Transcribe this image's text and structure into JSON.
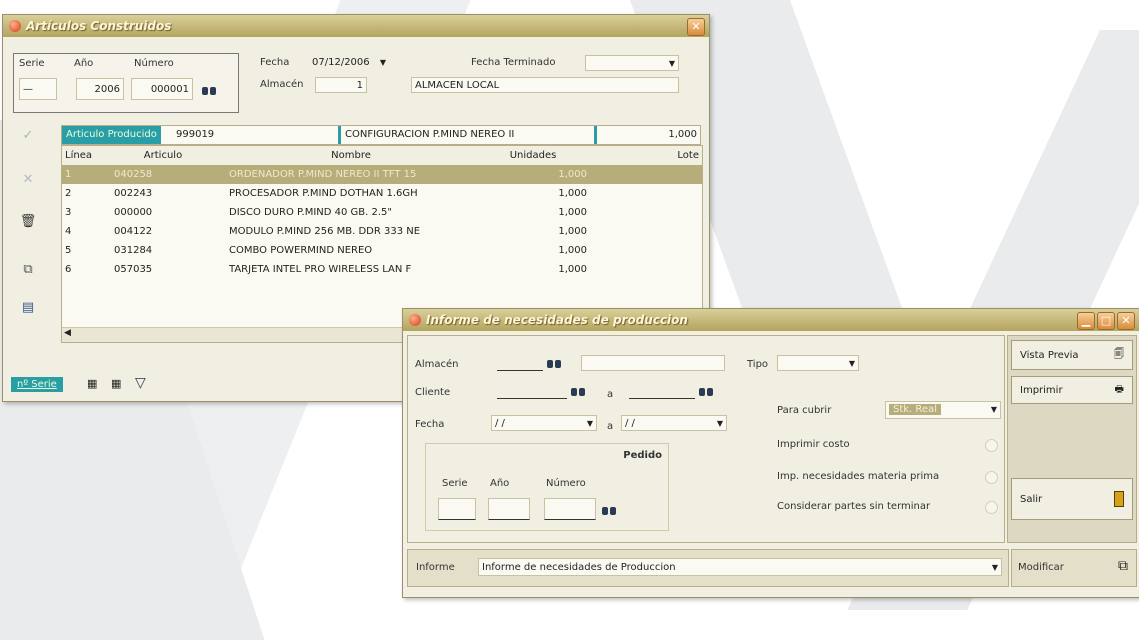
{
  "win1": {
    "title": "Artículos Construidos",
    "serie_label": "Serie",
    "anio_label": "Año",
    "numero_label": "Número",
    "serie_value": "—",
    "anio_value": "2006",
    "numero_value": "000001",
    "fecha_label": "Fecha",
    "fecha_value": "07/12/2006",
    "fecha_term_label": "Fecha Terminado",
    "fecha_term_value": "",
    "almacen_label": "Almacén",
    "almacen_value": "1",
    "almacen_name": "ALMACEN LOCAL",
    "producido_label": "Articulo Producido",
    "producido_code": "999019",
    "producido_name": "CONFIGURACION P.MIND NEREO II",
    "producido_qty": "1,000",
    "columns": [
      "Línea",
      "Articulo",
      "Nombre",
      "Unidades",
      "Lote"
    ],
    "rows": [
      {
        "line": "1",
        "article": "040258",
        "name": "ORDENADOR P.MIND NEREO II TFT 15",
        "units": "1,000",
        "lote": ""
      },
      {
        "line": "2",
        "article": "002243",
        "name": "PROCESADOR P.MIND DOTHAN 1.6GH",
        "units": "1,000",
        "lote": ""
      },
      {
        "line": "3",
        "article": "000000",
        "name": "DISCO DURO P.MIND 40 GB. 2.5\"",
        "units": "1,000",
        "lote": ""
      },
      {
        "line": "4",
        "article": "004122",
        "name": "MODULO P.MIND 256 MB. DDR 333 NE",
        "units": "1,000",
        "lote": ""
      },
      {
        "line": "5",
        "article": "031284",
        "name": "COMBO POWERMIND NEREO",
        "units": "1,000",
        "lote": ""
      },
      {
        "line": "6",
        "article": "057035",
        "name": "TARJETA INTEL PRO WIRELESS LAN F",
        "units": "1,000",
        "lote": ""
      }
    ],
    "nserie_label": "nº Serie"
  },
  "win2": {
    "title": "Informe de necesidades de produccion",
    "almacen_label": "Almacén",
    "cliente_label": "Cliente",
    "fecha_label": "Fecha",
    "a_label": "a",
    "tipo_label": "Tipo",
    "fecha_from": "/ /",
    "fecha_to": "/ /",
    "pedido_label": "Pedido",
    "serie_label": "Serie",
    "anio_label": "Año",
    "numero_label": "Número",
    "para_cubrir_label": "Para cubrir",
    "para_cubrir_value": "Stk. Real",
    "imprimir_costo_label": "Imprimir costo",
    "imp_necesidades_label": "Imp. necesidades materia prima",
    "considerar_label": "Considerar partes sin terminar",
    "vista_previa_label": "Vista Previa",
    "imprimir_label": "Imprimir",
    "salir_label": "Salir",
    "informe_label": "Informe",
    "informe_value": "Informe de necesidades de Produccion",
    "modificar_label": "Modificar"
  },
  "colors": {
    "accent": "#2a9ea6",
    "selected_row": "#b7ad7a",
    "title": "#c4b873"
  }
}
